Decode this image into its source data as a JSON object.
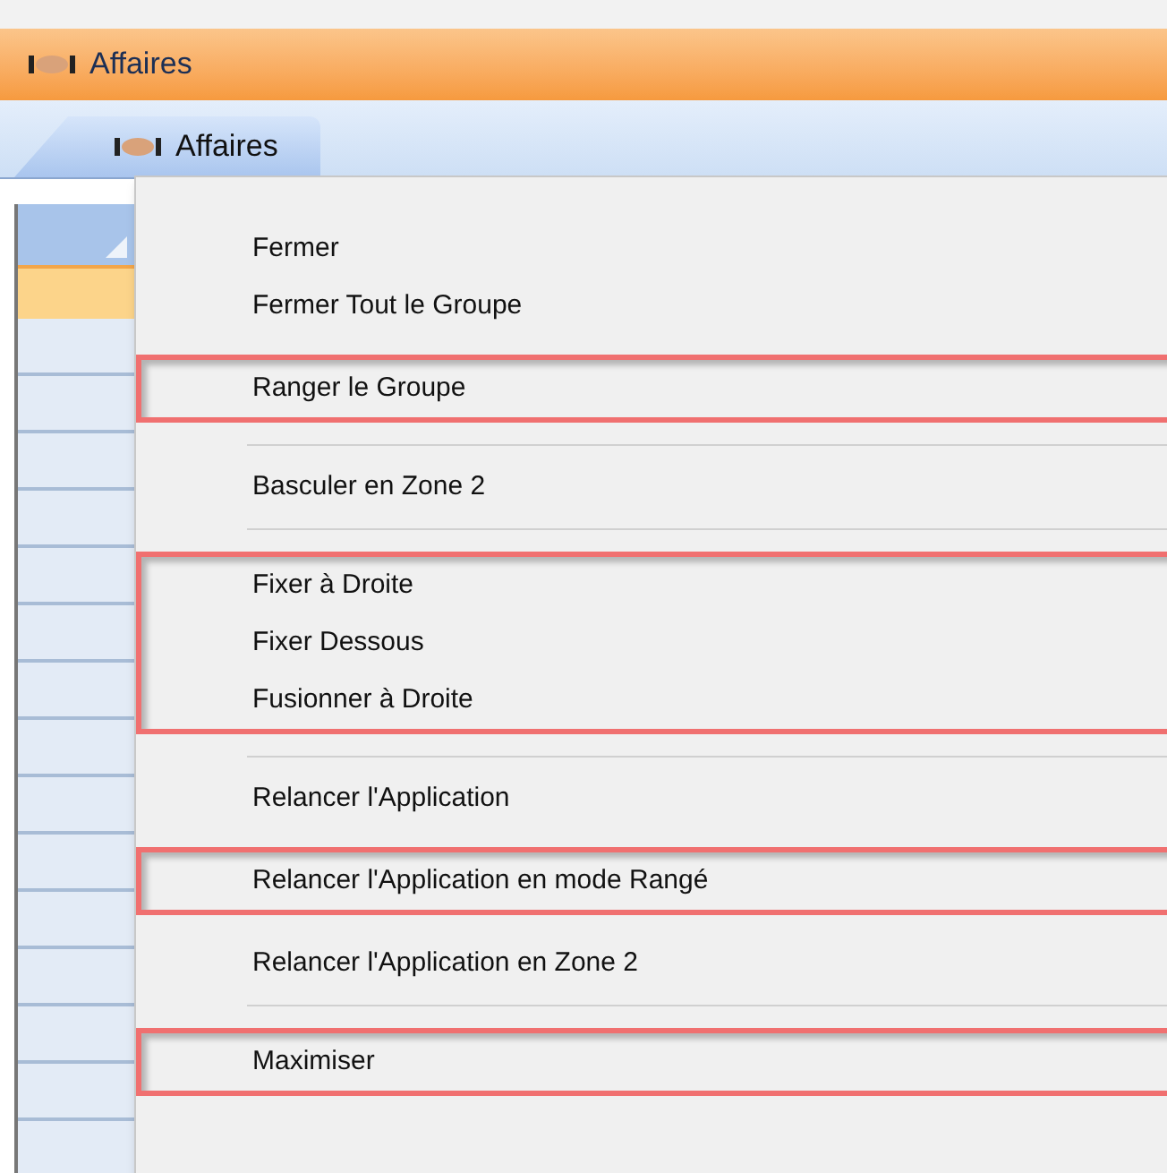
{
  "window": {
    "title": "Affaires"
  },
  "tabs": [
    {
      "label": "Affaires",
      "selected": true
    }
  ],
  "menu": {
    "entries": [
      {
        "kind": "group",
        "highlighted": false,
        "items": [
          "Fermer",
          "Fermer Tout le Groupe"
        ]
      },
      {
        "kind": "group",
        "highlighted": true,
        "items": [
          "Ranger le Groupe"
        ]
      },
      {
        "kind": "separator"
      },
      {
        "kind": "group",
        "highlighted": false,
        "items": [
          "Basculer en Zone 2"
        ]
      },
      {
        "kind": "separator"
      },
      {
        "kind": "group",
        "highlighted": true,
        "items": [
          "Fixer à Droite",
          "Fixer Dessous",
          "Fusionner à Droite"
        ]
      },
      {
        "kind": "separator"
      },
      {
        "kind": "group",
        "highlighted": false,
        "items": [
          "Relancer l'Application"
        ]
      },
      {
        "kind": "group",
        "highlighted": true,
        "items": [
          "Relancer l'Application en mode Rangé"
        ]
      },
      {
        "kind": "group",
        "highlighted": false,
        "items": [
          "Relancer l'Application en Zone 2"
        ]
      },
      {
        "kind": "separator"
      },
      {
        "kind": "group",
        "highlighted": true,
        "items": [
          "Maximiser"
        ]
      }
    ]
  }
}
